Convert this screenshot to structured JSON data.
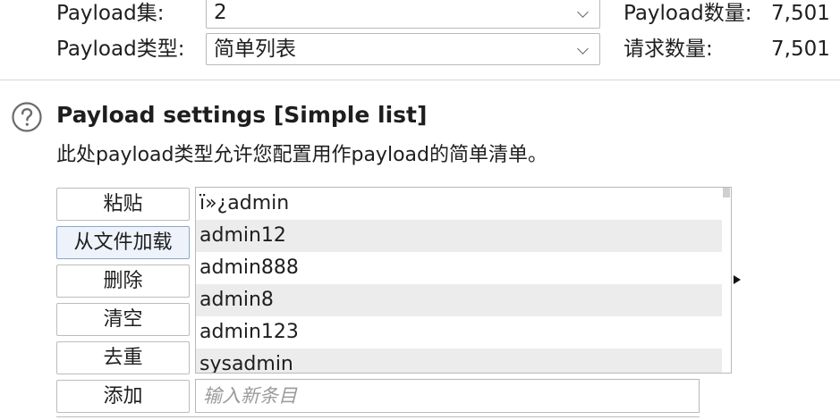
{
  "payload_set": {
    "label": "Payload集:",
    "value": "2",
    "count_label": "Payload数量:",
    "count_value": "7,501"
  },
  "payload_type": {
    "label": "Payload类型:",
    "value": "简单列表",
    "count_label": "请求数量:",
    "count_value": "7,501"
  },
  "settings": {
    "title": "Payload settings [Simple list]",
    "description": "此处payload类型允许您配置用作payload的简单清单。"
  },
  "buttons": {
    "paste": "粘贴",
    "load": "从文件加载",
    "remove": "删除",
    "clear": "清空",
    "dedupe": "去重",
    "add": "添加"
  },
  "list": {
    "items": [
      "ï»¿admin",
      "admin12",
      "admin888",
      "admin8",
      "admin123",
      "sysadmin"
    ]
  },
  "add_input": {
    "placeholder": "输入新条目",
    "value": ""
  },
  "icons": {
    "help": "help-circle-icon",
    "dropdown": "chevron-down-icon",
    "expand": "triangle-right-icon"
  },
  "colors": {
    "alt_row": "#ececec",
    "focused_button": "#eef3fb",
    "border": "#b9b9b9"
  }
}
